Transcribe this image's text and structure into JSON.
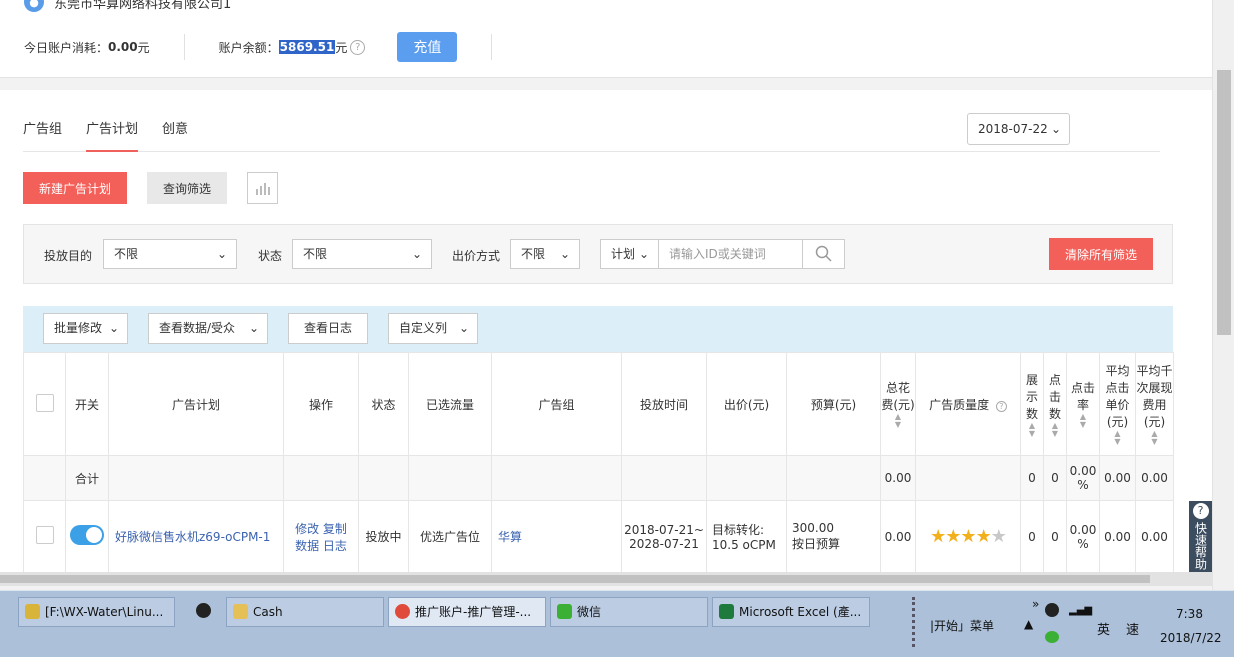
{
  "account": {
    "company": "东莞市华算网络科技有限公司1",
    "today_label": "今日账户消耗：",
    "today_value": "0.00",
    "today_unit": " 元",
    "balance_label": "账户余额：",
    "balance_value": "5869.51",
    "balance_unit": " 元",
    "recharge": "充值"
  },
  "tabs": [
    "广告组",
    "广告计划",
    "创意"
  ],
  "date": "2018-07-22",
  "actions": {
    "new_plan": "新建广告计划",
    "query_filter": "查询筛选"
  },
  "filters": {
    "goal_label": "投放目的",
    "goal_value": "不限",
    "status_label": "状态",
    "status_value": "不限",
    "bid_label": "出价方式",
    "bid_value": "不限",
    "search_scope": "计划",
    "search_placeholder": "请输入ID或关键词",
    "clear": "清除所有筛选"
  },
  "toolbar": {
    "batch": "批量修改",
    "view_data": "查看数据/受众",
    "log": "查看日志",
    "custom_cols": "自定义列"
  },
  "table": {
    "headers": {
      "switch": "开关",
      "plan": "广告计划",
      "ops": "操作",
      "status": "状态",
      "traffic": "已选流量",
      "group": "广告组",
      "time": "投放时间",
      "bid": "出价(元)",
      "budget": "预算(元)",
      "cost": "总花费(元)",
      "quality": "广告质量度",
      "impressions": "展示数",
      "clicks": "点击数",
      "ctr": "点击率",
      "cpc": "平均点击单价(元)",
      "cpm": "平均千次展现费用(元)"
    },
    "summary": {
      "label": "合计",
      "cost": "0.00",
      "impressions": "0",
      "clicks": "0",
      "ctr": "0.00 %",
      "cpc": "0.00",
      "cpm": "0.00"
    },
    "rows": [
      {
        "plan": "好脉微信售水机z69-oCPM-1",
        "op_edit": "修改",
        "op_copy": "复制",
        "op_data": "数据",
        "op_log": "日志",
        "status": "投放中",
        "traffic": "优选广告位",
        "group": "华算",
        "time_start": "2018-07-21~",
        "time_end": "2028-07-21",
        "bid": "目标转化: 10.5 oCPM",
        "budget_value": "300.00",
        "budget_type": "按日预算",
        "cost": "0.00",
        "quality_stars": 3.5,
        "impressions": "0",
        "clicks": "0",
        "ctr": "0.00 %",
        "cpc": "0.00",
        "cpm": "0.00"
      }
    ]
  },
  "help_tab": "快速帮助",
  "taskbar": {
    "tasks": [
      "[F:\\WX-Water\\Linu...",
      "Cash",
      "推广账户-推广管理-...",
      "微信",
      "Microsoft Excel (產..."
    ],
    "start_menu": "|开始」菜单",
    "lang": "英",
    "speed": "速",
    "time": "7:38",
    "date": "2018/7/22"
  },
  "colors": {
    "primary_red": "#f3605a",
    "primary_blue": "#5b9ef0",
    "toggle_on": "#3ba0e6",
    "link": "#3b63b0"
  }
}
